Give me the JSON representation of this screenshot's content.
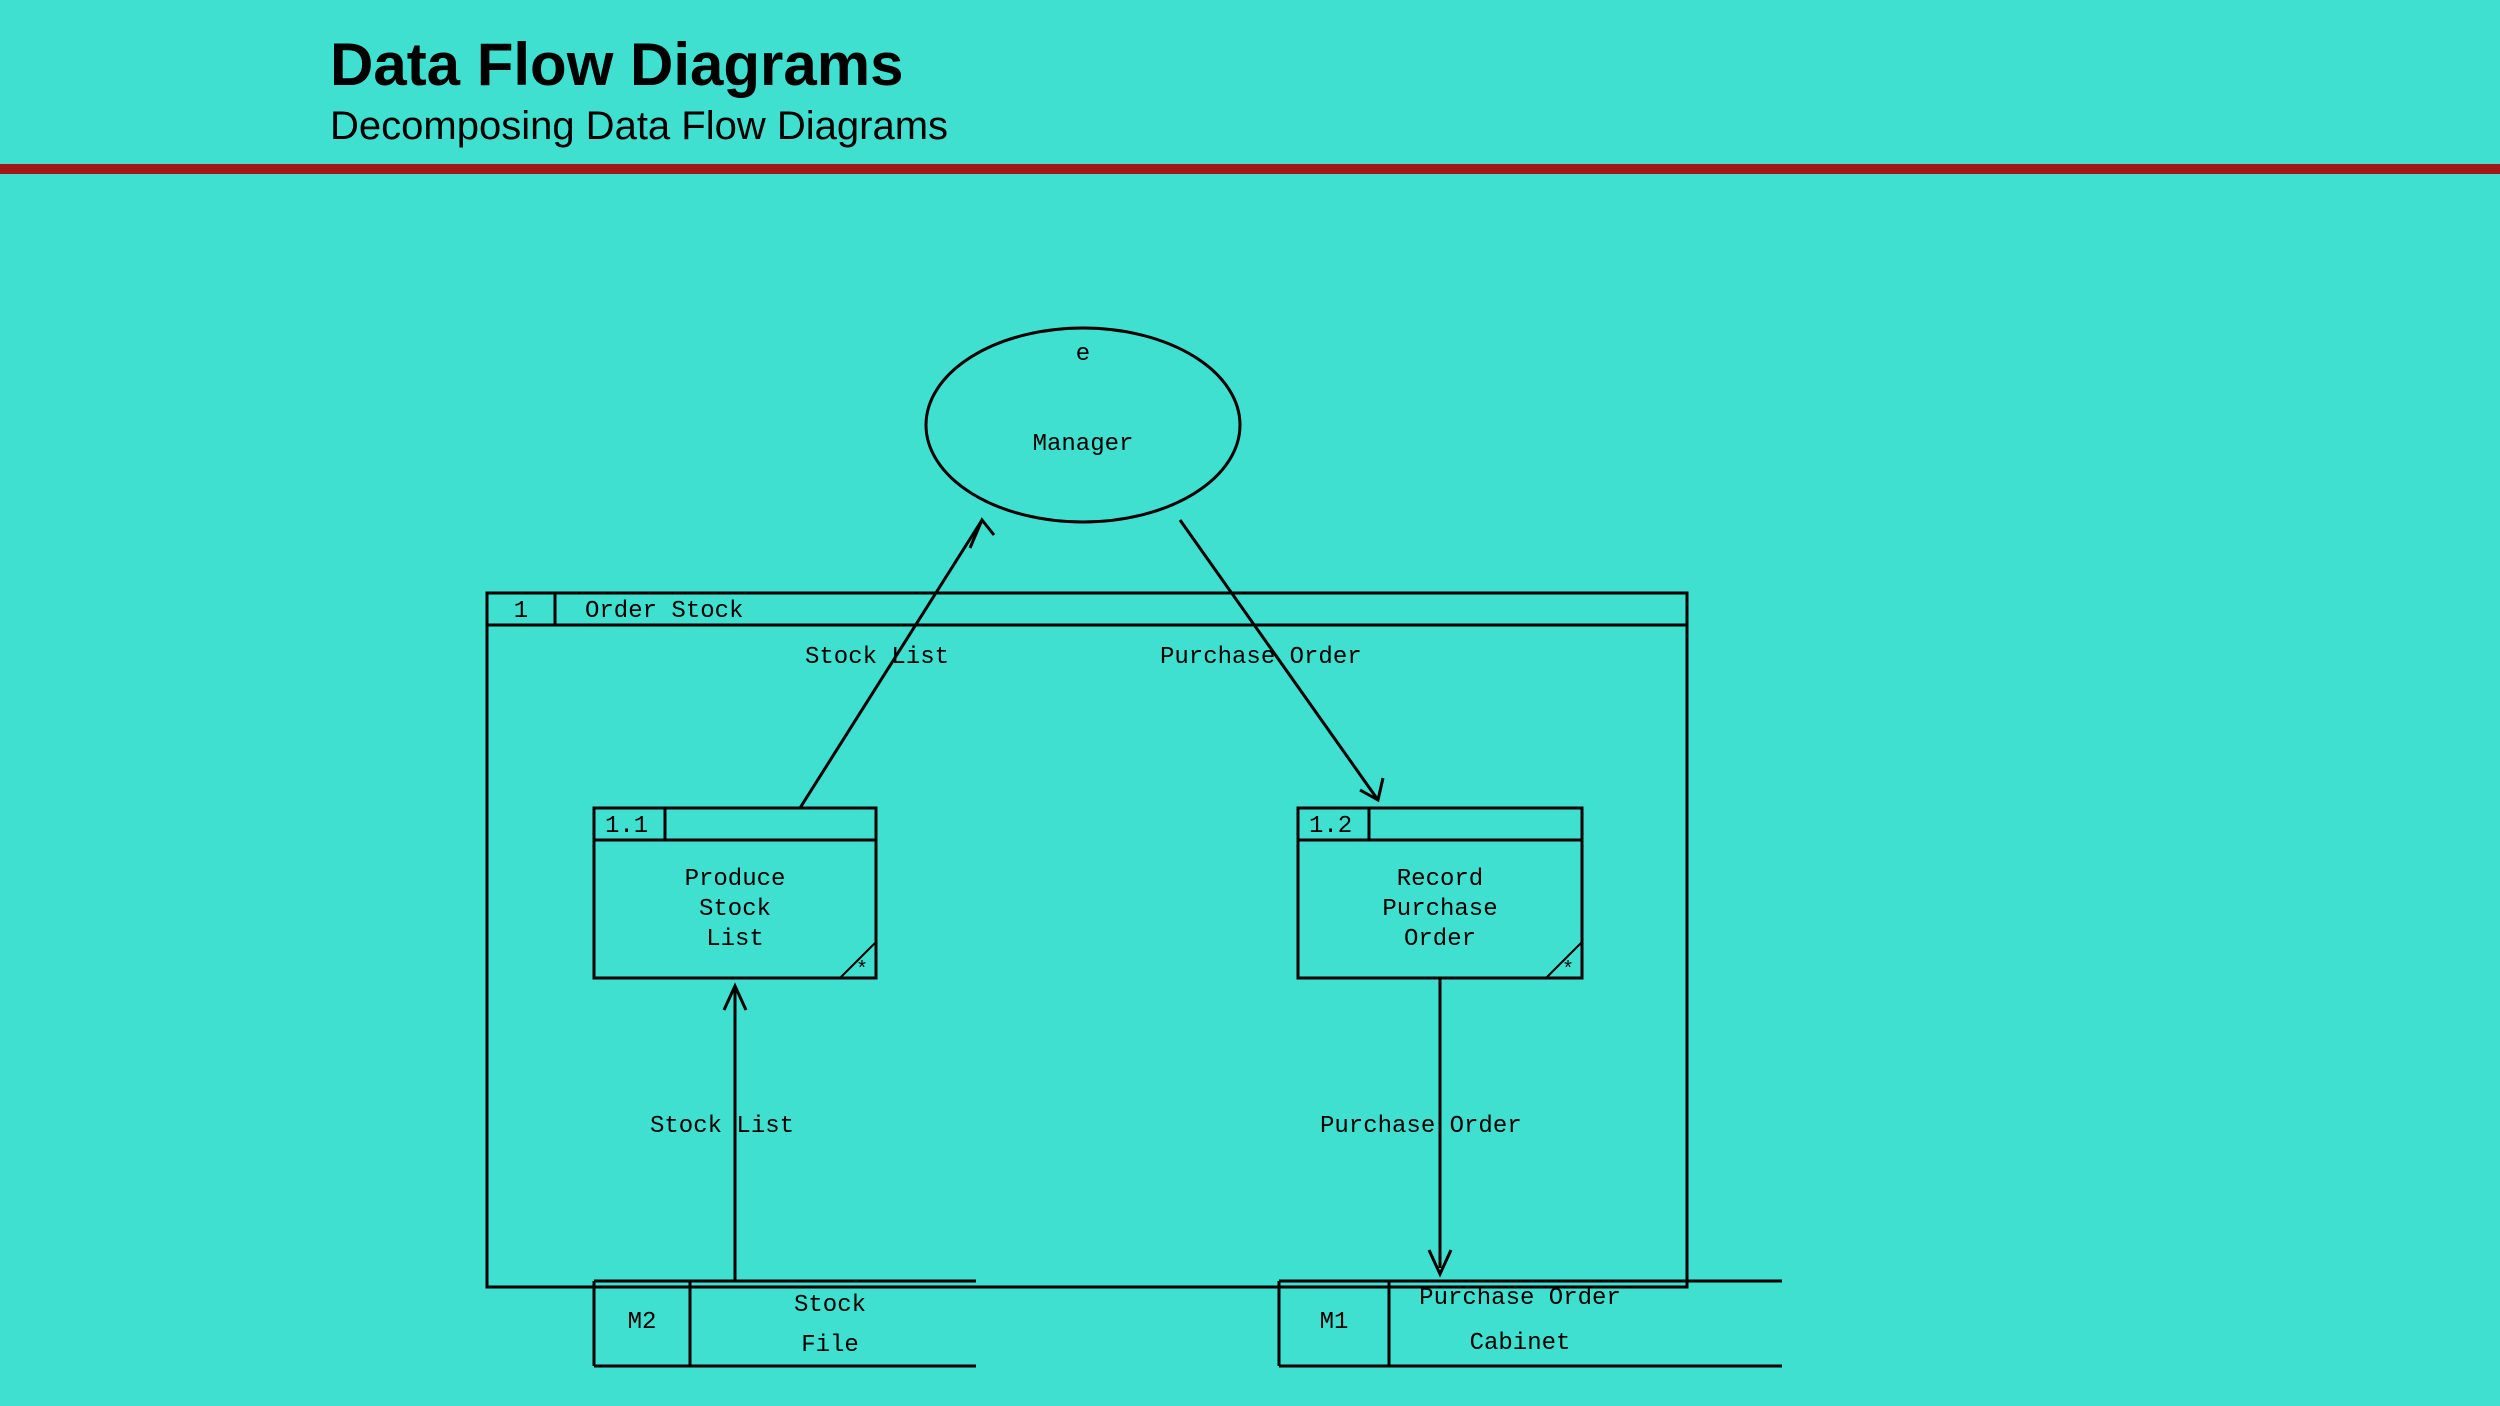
{
  "header": {
    "title": "Data Flow Diagrams",
    "subtitle": "Decomposing Data Flow Diagrams"
  },
  "external_entity": {
    "id": "e",
    "label": "Manager"
  },
  "container": {
    "id": "1",
    "title": "Order Stock"
  },
  "processes": {
    "p11": {
      "id": "1.1",
      "line1": "Produce",
      "line2": "Stock",
      "line3": "List",
      "marker": "*"
    },
    "p12": {
      "id": "1.2",
      "line1": "Record",
      "line2": "Purchase",
      "line3": "Order",
      "marker": "*"
    }
  },
  "flows": {
    "top_left": "Stock List",
    "top_right": "Purchase Order",
    "bottom_left": "Stock List",
    "bottom_right": "Purchase Order"
  },
  "datastores": {
    "m2": {
      "id": "M2",
      "line1": "Stock",
      "line2": "File"
    },
    "m1": {
      "id": "M1",
      "line1": "Purchase Order",
      "line2": "Cabinet"
    }
  }
}
